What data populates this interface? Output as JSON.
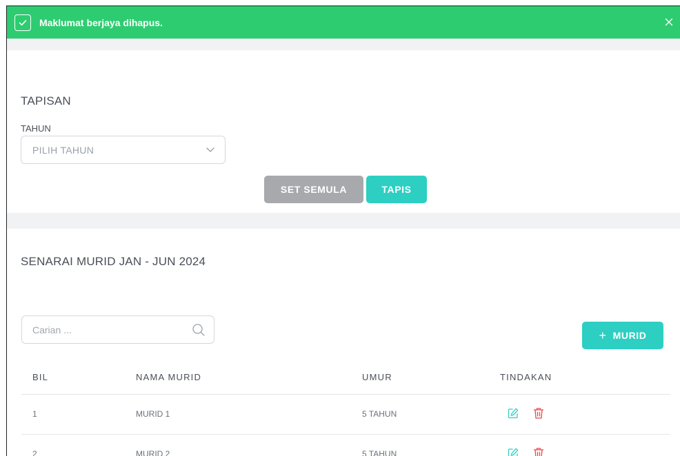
{
  "toast": {
    "message": "Maklumat berjaya dihapus.",
    "color": "#2ecc71"
  },
  "filter": {
    "title": "TAPISAN",
    "year_label": "TAHUN",
    "year_placeholder": "PILIH TAHUN",
    "reset_label": "SET SEMULA",
    "apply_label": "TAPIS"
  },
  "list": {
    "title": "SENARAI MURID JAN - JUN 2024",
    "search_placeholder": "Carian ...",
    "add_label": "MURID",
    "columns": {
      "no": "BIL",
      "name": "NAMA MURID",
      "age": "UMUR",
      "actions": "TINDAKAN"
    },
    "rows": [
      {
        "no": "1",
        "name": "MURID 1",
        "age": "5 TAHUN"
      },
      {
        "no": "2",
        "name": "MURID 2",
        "age": "5 TAHUN"
      }
    ]
  },
  "colors": {
    "accent": "#2dcfc2",
    "reset": "#a7a9ad",
    "edit_icon": "#2dcfc2",
    "delete_icon": "#e5484d"
  },
  "icons": {
    "toast": "check-icon",
    "close": "close-icon",
    "select": "chevron-down-icon",
    "search": "search-icon",
    "edit": "edit-icon",
    "delete": "trash-icon"
  }
}
